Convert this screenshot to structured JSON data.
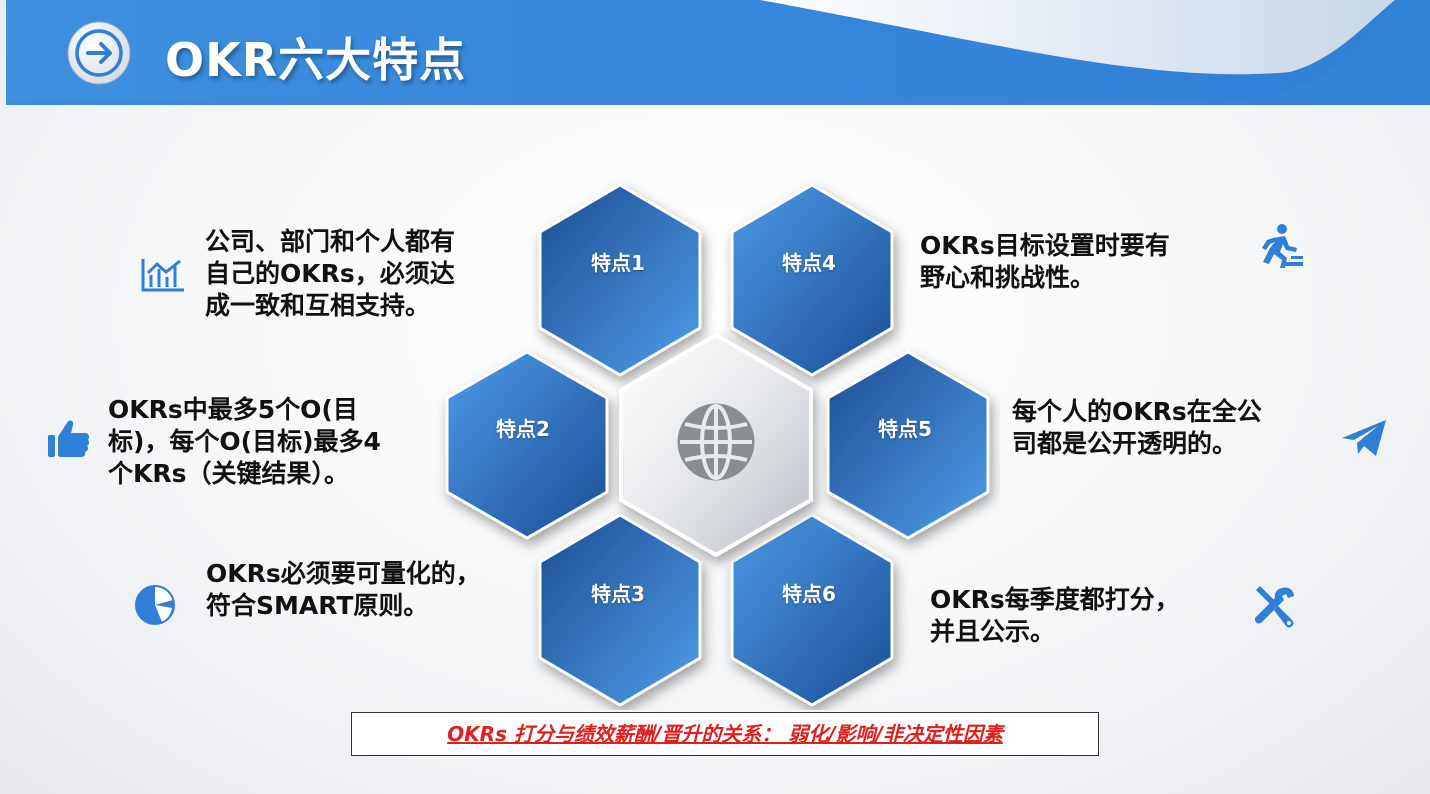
{
  "slide": {
    "title": "OKR六大特点",
    "accent_color": "#3d8fe0"
  },
  "hexagons": [
    {
      "label": "特点1"
    },
    {
      "label": "特点2"
    },
    {
      "label": "特点3"
    },
    {
      "label": "特点4"
    },
    {
      "label": "特点5"
    },
    {
      "label": "特点6"
    }
  ],
  "center_icon": "globe-icon",
  "features": [
    {
      "icon": "chart-icon",
      "lines": [
        "公司、部门和个人都有",
        "自己的OKRs，必须达",
        "成一致和互相支持。"
      ]
    },
    {
      "icon": "thumbs-up-icon",
      "lines": [
        "OKRs中最多5个O(目",
        "标)，每个O(目标)最多4",
        "个KRs（关键结果）。"
      ]
    },
    {
      "icon": "pie-chart-icon",
      "lines": [
        "OKRs必须要可量化的，",
        "符合SMART原则。"
      ]
    },
    {
      "icon": "runner-icon",
      "lines": [
        "OKRs目标设置时要有",
        "野心和挑战性。"
      ]
    },
    {
      "icon": "paper-plane-icon",
      "lines": [
        "每个人的OKRs在全公",
        "司都是公开透明的。"
      ]
    },
    {
      "icon": "tools-icon",
      "lines": [
        "OKRs每季度都打分，",
        "并且公示。"
      ]
    }
  ],
  "note": "OKRs 打分与绩效薪酬/晋升的关系： 弱化/影响/非决定性因素"
}
